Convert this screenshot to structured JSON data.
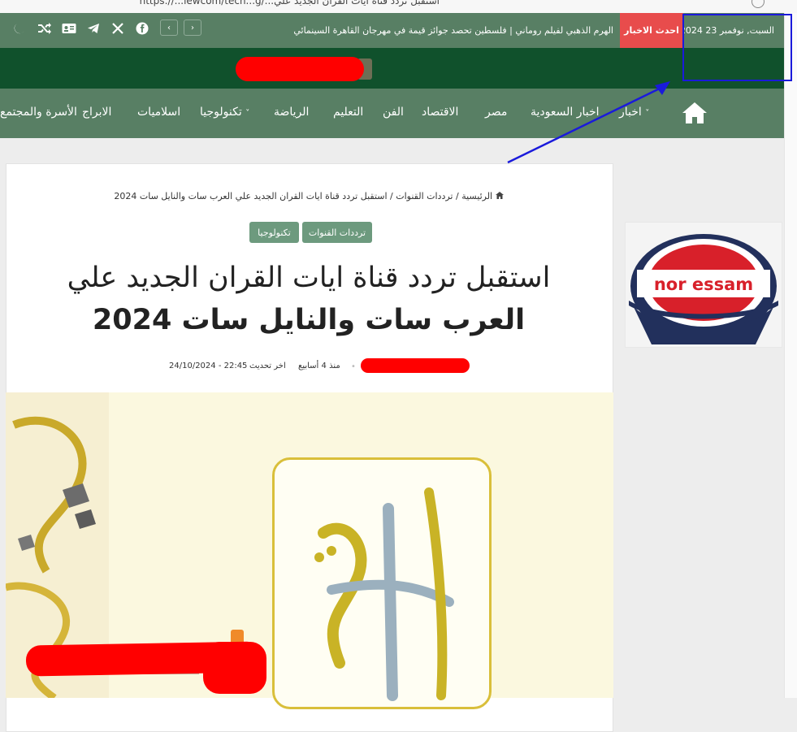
{
  "browser": {
    "url_fragment": "https://...iewcom/tech...g/...استقبل تردد قناة ايات القران الجديد علي"
  },
  "topbar": {
    "date": "السبت, نوفمبر 23 2024",
    "breaking_label": "احدث الاخبار",
    "ticker_text": "الهرم الذهبي لفيلم روماني | فلسطين تحصد جوائز قيمة في مهرجان القاهرة السينمائي",
    "prev_arrow": "‹",
    "next_arrow": "›",
    "social_icons": [
      "facebook-icon",
      "x-icon",
      "telegram-icon",
      "id-card-icon",
      "shuffle-icon",
      "moon-icon"
    ]
  },
  "nav": {
    "items": [
      {
        "label": "اخبار",
        "has_dropdown": true
      },
      {
        "label": "اخبار السعودية"
      },
      {
        "label": "مصر"
      },
      {
        "label": "الاقتصاد"
      },
      {
        "label": "الفن"
      },
      {
        "label": "التعليم"
      },
      {
        "label": "الرياضة"
      },
      {
        "label": "تكنولوجيا",
        "has_dropdown": true
      },
      {
        "label": "اسلاميات"
      },
      {
        "label": "الابراج"
      },
      {
        "label": "الأسرة والمجتمع"
      }
    ]
  },
  "article": {
    "breadcrumb": {
      "home": "الرئيسية",
      "sep": "/",
      "category": "ترددات القنوات",
      "current": "استقبل تردد قناة ايات القران الجديد علي العرب سات والنايل سات 2024"
    },
    "categories": [
      "ترددات القنوات",
      "تكنولوجيا"
    ],
    "title_line1": "استقبل تردد قناة ايات القران الجديد علي",
    "title_line2": "العرب سات والنايل سات 2024",
    "posted_ago": "منذ 4 أسابيع",
    "last_update_label": "اخر تحديث",
    "last_update_value": "24/10/2024 - 22:45"
  },
  "sidebar": {
    "logo_text": "nor essam"
  },
  "colors": {
    "topbar": "#587f64",
    "header": "#10512c",
    "breaking": "#e84c4c",
    "badge": "#6d9a7e",
    "annotation": "#1a1adb"
  }
}
